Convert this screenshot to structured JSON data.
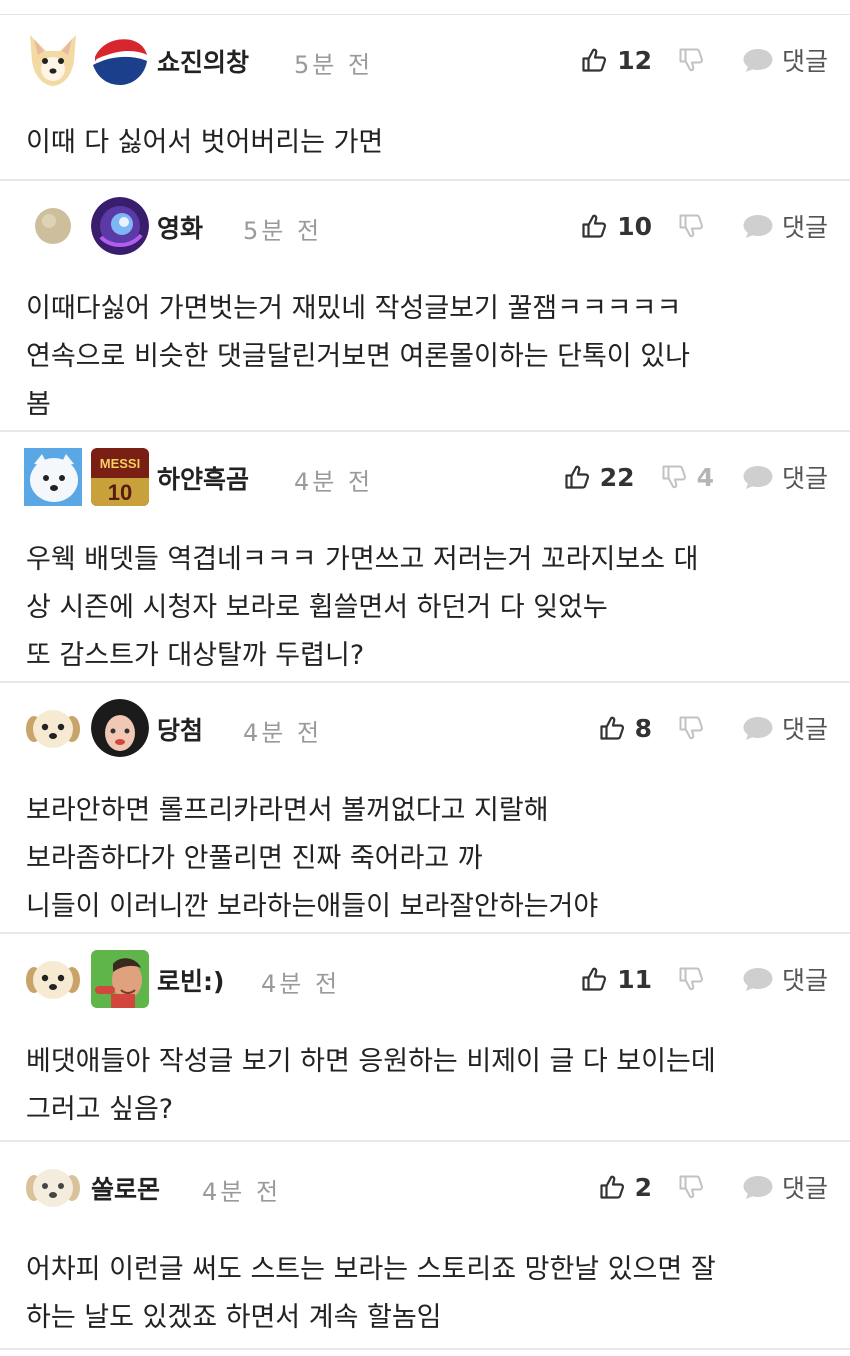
{
  "icon_names": {
    "like": "thumbs-up-icon",
    "dislike": "thumbs-down-icon",
    "reply": "speech-bubble-icon"
  },
  "colors": {
    "text": "#222222",
    "time": "#9a9a9a",
    "dislike_inactive": "#b5b5b5",
    "divider": "#e8e8e8"
  },
  "comments": [
    {
      "username": "쇼진의창",
      "time": "5분 전",
      "likes": "12",
      "dislikes": "",
      "reply_label": "댓글",
      "lines": [
        "이때 다 싫어서 벗어버리는 가면"
      ]
    },
    {
      "username": "영화",
      "time": "5분 전",
      "likes": "10",
      "dislikes": "",
      "reply_label": "댓글",
      "lines": [
        "이때다싫어 가면벗는거 재밌네 작성글보기 꿀잼ㅋㅋㅋㅋㅋ",
        "연속으로 비슷한 댓글달린거보면 여론몰이하는 단톡이 있나",
        "봄"
      ]
    },
    {
      "username": "하얀흑곰",
      "time": "4분 전",
      "likes": "22",
      "dislikes": "4",
      "reply_label": "댓글",
      "avatar_text": "MESSI",
      "lines": [
        "우웩 배뎃들 역겹네ㅋㅋㅋ 가면쓰고 저러는거 꼬라지보소 대",
        "상 시즌에 시청자 보라로 휩쓸면서 하던거 다 잊었누",
        "또 감스트가 대상탈까 두렵니?"
      ]
    },
    {
      "username": "당첨",
      "time": "4분 전",
      "likes": "8",
      "dislikes": "",
      "reply_label": "댓글",
      "lines": [
        "보라안하면 롤프리카라면서 볼꺼없다고 지랄해",
        "보라좀하다가 안풀리면 진짜 죽어라고 까",
        "니들이 이러니깐 보라하는애들이 보라잘안하는거야"
      ]
    },
    {
      "username": "로빈:)",
      "time": "4분 전",
      "likes": "11",
      "dislikes": "",
      "reply_label": "댓글",
      "lines": [
        "베댓애들아 작성글 보기 하면 응원하는 비제이 글 다 보이는데",
        "그러고 싶음?"
      ]
    },
    {
      "username": "쏠로몬",
      "time": "4분 전",
      "likes": "2",
      "dislikes": "",
      "reply_label": "댓글",
      "lines": [
        "어차피 이런글 써도 스트는 보라는 스토리죠 망한날 있으면 잘",
        "하는 날도 있겠죠 하면서 계속 할놈임"
      ]
    }
  ]
}
